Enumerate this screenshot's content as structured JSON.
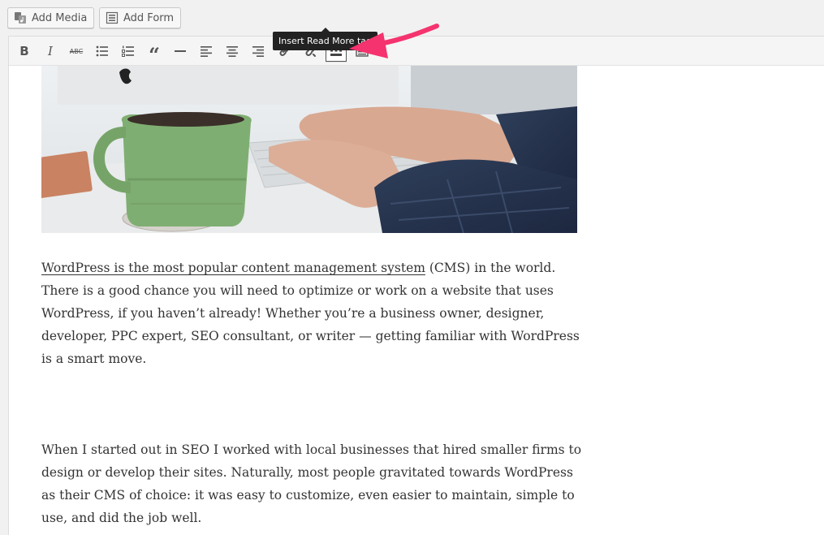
{
  "media_buttons": {
    "add_media_label": "Add Media",
    "add_form_label": "Add Form"
  },
  "toolbar": {
    "buttons": [
      {
        "name": "bold",
        "icon": "bold-icon",
        "glyph": "B"
      },
      {
        "name": "italic",
        "icon": "italic-icon",
        "glyph": "I"
      },
      {
        "name": "strikethrough",
        "icon": "strikethrough-icon",
        "glyph": "ABC"
      },
      {
        "name": "bulleted-list",
        "icon": "bulleted-list-icon"
      },
      {
        "name": "numbered-list",
        "icon": "numbered-list-icon"
      },
      {
        "name": "blockquote",
        "icon": "blockquote-icon",
        "glyph": "“"
      },
      {
        "name": "horizontal-line",
        "icon": "horizontal-line-icon"
      },
      {
        "name": "align-left",
        "icon": "align-left-icon"
      },
      {
        "name": "align-center",
        "icon": "align-center-icon"
      },
      {
        "name": "align-right",
        "icon": "align-right-icon"
      },
      {
        "name": "insert-link",
        "icon": "link-icon"
      },
      {
        "name": "remove-link",
        "icon": "unlink-icon"
      },
      {
        "name": "read-more",
        "icon": "read-more-icon",
        "active": true
      },
      {
        "name": "toolbar-toggle",
        "icon": "toolbar-toggle-icon"
      }
    ],
    "tooltip": "Insert Read More tag"
  },
  "post": {
    "paragraph1": {
      "link_text": "WordPress is the most popular content management system",
      "text": " (CMS) in the world. There is a good chance you will need to optimize or work on a website that uses WordPress, if you haven’t already! Whether you’re a business owner, designer, developer, PPC expert, SEO consultant, or writer — getting familiar with WordPress is a smart move."
    },
    "paragraph2": "When I started out in SEO I worked with local businesses that hired smaller firms to design or develop their sites. Naturally, most people gravitated towards WordPress as their CMS of choice: it was easy to customize, even easier to maintain, simple to use, and did the job well."
  },
  "colors": {
    "annotation_arrow": "#f5336e",
    "tooltip_bg": "#222222",
    "mug": "#7fae72"
  }
}
